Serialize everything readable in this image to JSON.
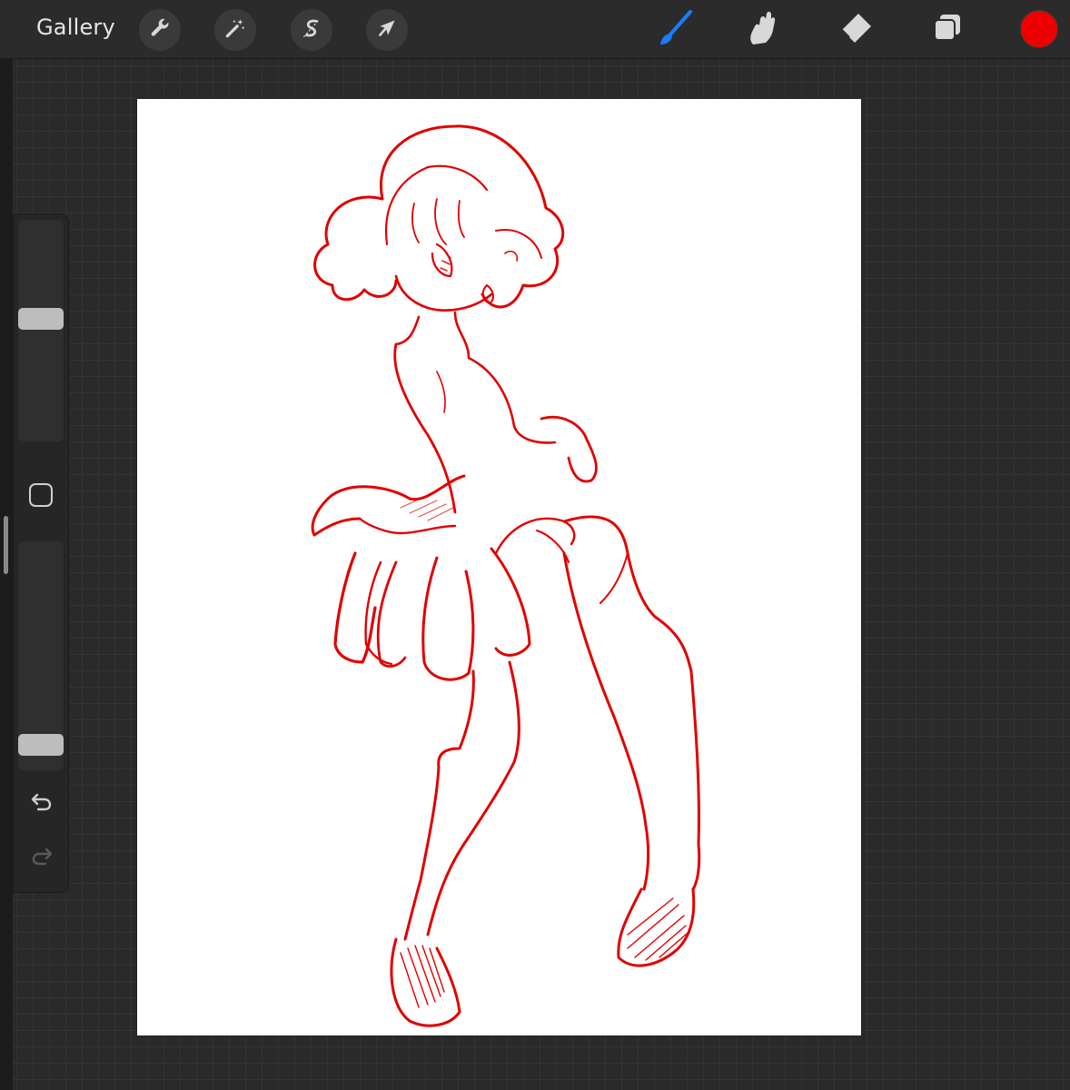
{
  "toolbar": {
    "gallery_label": "Gallery",
    "left_tools": [
      {
        "name": "actions",
        "icon": "wrench-icon"
      },
      {
        "name": "adjustments",
        "icon": "magic-wand-icon"
      },
      {
        "name": "selection",
        "icon": "selection-s-icon"
      },
      {
        "name": "transform",
        "icon": "arrow-cursor-icon"
      }
    ],
    "right_tools": [
      {
        "name": "brush",
        "icon": "paintbrush-icon",
        "active": true
      },
      {
        "name": "smudge",
        "icon": "smudge-finger-icon",
        "active": false
      },
      {
        "name": "eraser",
        "icon": "eraser-icon",
        "active": false
      },
      {
        "name": "layers",
        "icon": "layers-icon",
        "active": false
      }
    ],
    "active_tool_color": "#1a7cff",
    "current_color": "#ee0000"
  },
  "sidebar": {
    "brush_size": 0.56,
    "brush_opacity": 0.07,
    "modify_icon": "square-outline-icon",
    "undo_icon": "undo-arrow-icon",
    "redo_icon": "redo-arrow-icon",
    "redo_enabled": false
  },
  "canvas": {
    "background_color": "#ffffff",
    "stroke_color": "#e10000",
    "content": "sketch-figure"
  }
}
